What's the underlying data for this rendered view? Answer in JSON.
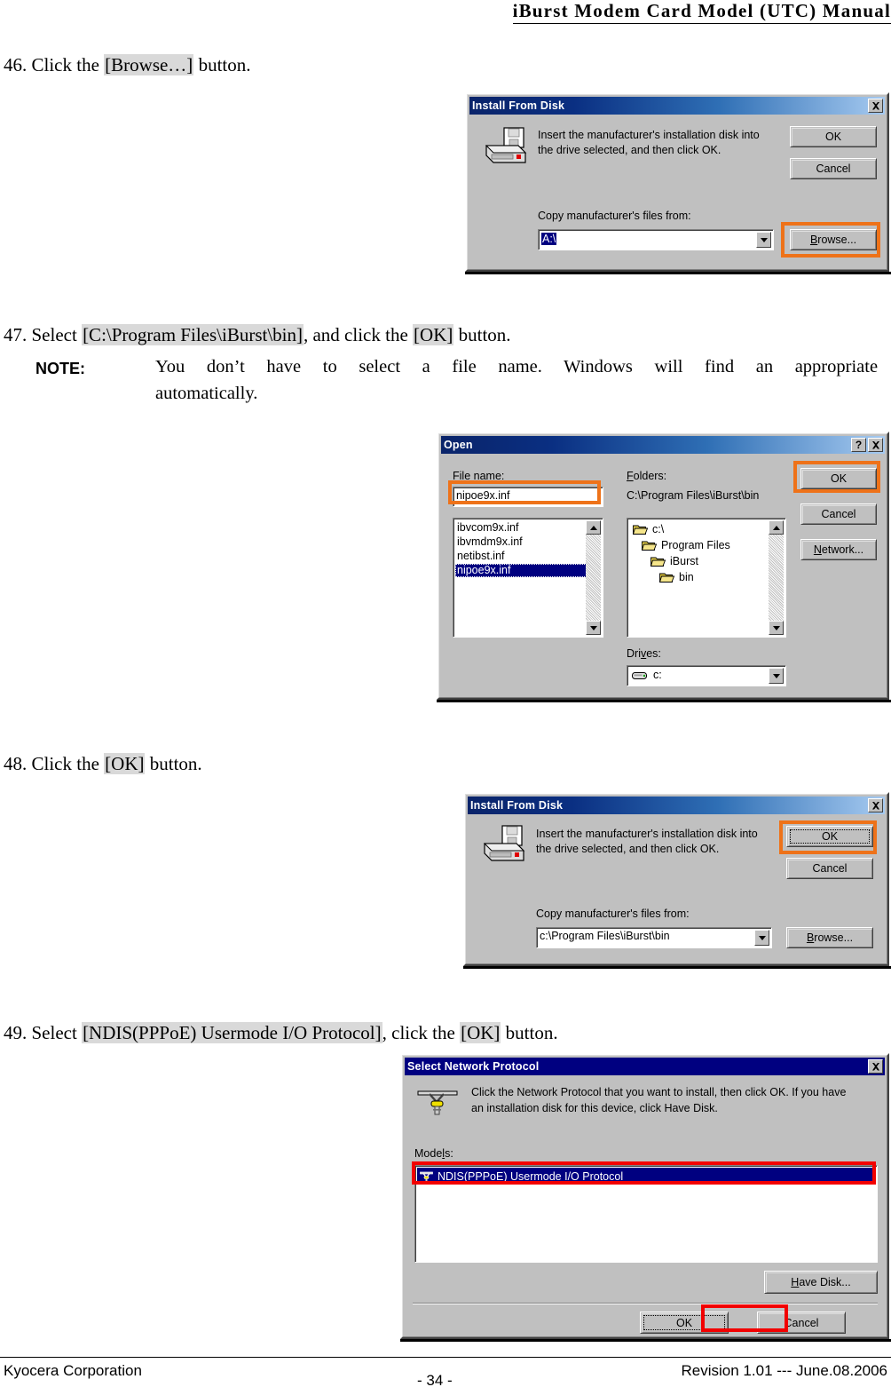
{
  "header": {
    "title": "iBurst Modem Card Model (UTC) Manual"
  },
  "steps": {
    "s46": {
      "num": "46.",
      "pre": "Click the",
      "hl": "[Browse…]",
      "post": "button."
    },
    "s47": {
      "num": "47.",
      "pre": "Select",
      "hl1": "[C:\\Program Files\\iBurst\\bin]",
      "mid": ", and click the",
      "hl2": "[OK]",
      "post": "button."
    },
    "s48": {
      "num": "48.",
      "pre": "Click the",
      "hl": "[OK]",
      "post": "button."
    },
    "s49": {
      "num": "49.",
      "pre": "Select",
      "hl1": "[NDIS(PPPoE) Usermode I/O Protocol]",
      "mid": ", click the",
      "hl2": "[OK]",
      "post": "button."
    }
  },
  "note": {
    "label": "NOTE:",
    "line1": "You don’t have to select a file name.  Windows will find an appropriate file",
    "line2": "automatically."
  },
  "dialog_install_1": {
    "title": "Install From Disk",
    "close_label": "✕",
    "icon": "floppy-drive-icon",
    "message_line1": "Insert the manufacturer's installation disk into",
    "message_line2": "the drive selected, and then click OK.",
    "ok_label": "OK",
    "cancel_label": "Cancel",
    "copy_from_label": "Copy manufacturer's files from:",
    "path_value": "A:\\",
    "browse_label": "Browse...",
    "browse_accel": "B",
    "highlight_target": "browse-button",
    "highlight_color": "#ee7219"
  },
  "dialog_open": {
    "title": "Open",
    "help_label": "?",
    "close_label": "✕",
    "file_name_label": "File name:",
    "file_name_accel": "n",
    "file_name_value": "nipoe9x.inf",
    "files": [
      "ibvcom9x.inf",
      "ibvmdm9x.inf",
      "netibst.inf",
      "nipoe9x.inf"
    ],
    "selected_file": "nipoe9x.inf",
    "folders_label": "Folders:",
    "folders_accel": "F",
    "current_path": "C:\\Program Files\\iBurst\\bin",
    "folder_tree": [
      {
        "name": "c:\\",
        "depth": 0
      },
      {
        "name": "Program Files",
        "depth": 1
      },
      {
        "name": "iBurst",
        "depth": 2
      },
      {
        "name": "bin",
        "depth": 3
      }
    ],
    "drives_label": "Drives:",
    "drives_accel": "v",
    "drives_value": "c:",
    "ok_label": "OK",
    "cancel_label": "Cancel",
    "network_label": "Network...",
    "network_accel": "N",
    "highlight_targets": [
      "file-name-input",
      "ok-button"
    ],
    "highlight_color": "#ee7219"
  },
  "dialog_install_2": {
    "title": "Install From Disk",
    "close_label": "✕",
    "icon": "floppy-drive-icon",
    "message_line1": "Insert the manufacturer's installation disk into",
    "message_line2": "the drive selected, and then click OK.",
    "ok_label": "OK",
    "cancel_label": "Cancel",
    "copy_from_label": "Copy manufacturer's files from:",
    "path_value": "c:\\Program Files\\iBurst\\bin",
    "browse_label": "Browse...",
    "browse_accel": "B",
    "highlight_target": "ok-button",
    "highlight_color": "#ee7219"
  },
  "dialog_protocol": {
    "title": "Select Network Protocol",
    "close_label": "✕",
    "icon": "network-protocol-icon",
    "message_line1": "Click the Network Protocol that you want to install, then click OK. If you have",
    "message_line2": "an installation disk for this device, click Have Disk.",
    "models_label": "Models:",
    "models_accel": "l",
    "models": [
      "NDIS(PPPoE) Usermode I/O Protocol"
    ],
    "selected_model": "NDIS(PPPoE) Usermode I/O Protocol",
    "have_disk_label": "Have Disk...",
    "have_disk_accel": "H",
    "ok_label": "OK",
    "cancel_label": "Cancel",
    "highlight_targets": [
      "selected-model-row",
      "ok-button"
    ],
    "highlight_color": "#f20000"
  },
  "footer": {
    "left": "Kyocera Corporation",
    "center": "- 34 -",
    "right": "Revision 1.01 --- June.08.2006"
  }
}
